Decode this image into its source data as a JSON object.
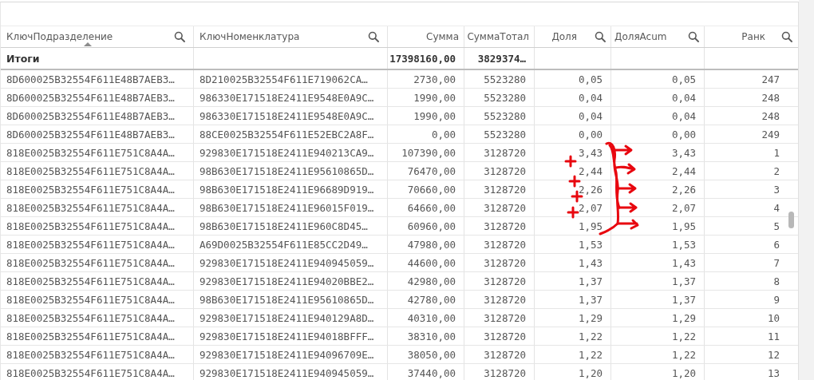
{
  "table": {
    "columns": [
      {
        "label": "КлючПодразделение",
        "kind": "dimension",
        "searchable": true,
        "sorted": true
      },
      {
        "label": "КлючНоменклатура",
        "kind": "dimension",
        "searchable": true,
        "sorted": false
      },
      {
        "label": "Сумма",
        "kind": "measure",
        "searchable": false,
        "sorted": false
      },
      {
        "label": "СуммаТотал",
        "kind": "measure",
        "searchable": false,
        "sorted": false
      },
      {
        "label": "Доля",
        "kind": "measure",
        "searchable": true,
        "sorted": false
      },
      {
        "label": "ДоляAcum",
        "kind": "measure",
        "searchable": true,
        "sorted": false
      },
      {
        "label": "Ранк",
        "kind": "measure",
        "searchable": true,
        "sorted": false
      }
    ],
    "totals": {
      "column_1": "Итоги",
      "column_3": "17398160,00",
      "column_4": "3829374…"
    },
    "rows": [
      [
        "8D600025B32554F611E48B7AEB3…",
        "8D210025B32554F611E719062CA…",
        "2730,00",
        "5523280",
        "0,05",
        "0,05",
        "247"
      ],
      [
        "8D600025B32554F611E48B7AEB3…",
        "986330E171518E2411E9548E0A9C…",
        "1990,00",
        "5523280",
        "0,04",
        "0,04",
        "248"
      ],
      [
        "8D600025B32554F611E48B7AEB3…",
        "986330E171518E2411E9548E0A9C…",
        "1990,00",
        "5523280",
        "0,04",
        "0,04",
        "248"
      ],
      [
        "8D600025B32554F611E48B7AEB3…",
        "88CE0025B32554F611E52EBC2A8F…",
        "0,00",
        "5523280",
        "0,00",
        "0,00",
        "249"
      ],
      [
        "818E0025B32554F611E751C8A4A…",
        "929830E171518E2411E940213CA9…",
        "107390,00",
        "3128720",
        "3,43",
        "3,43",
        "1"
      ],
      [
        "818E0025B32554F611E751C8A4A…",
        "98B630E171518E2411E95610865D…",
        "76470,00",
        "3128720",
        "2,44",
        "2,44",
        "2"
      ],
      [
        "818E0025B32554F611E751C8A4A…",
        "98B630E171518E2411E96689D919…",
        "70660,00",
        "3128720",
        "2,26",
        "2,26",
        "3"
      ],
      [
        "818E0025B32554F611E751C8A4A…",
        "98B630E171518E2411E96015F019…",
        "64660,00",
        "3128720",
        "2,07",
        "2,07",
        "4"
      ],
      [
        "818E0025B32554F611E751C8A4A…",
        "98B630E171518E2411E960C8D45…",
        "60960,00",
        "3128720",
        "1,95",
        "1,95",
        "5"
      ],
      [
        "818E0025B32554F611E751C8A4A…",
        "A69D0025B32554F611E85CC2D49…",
        "47980,00",
        "3128720",
        "1,53",
        "1,53",
        "6"
      ],
      [
        "818E0025B32554F611E751C8A4A…",
        "929830E171518E2411E940945059…",
        "44600,00",
        "3128720",
        "1,43",
        "1,43",
        "7"
      ],
      [
        "818E0025B32554F611E751C8A4A…",
        "929830E171518E2411E94020BBE2…",
        "42980,00",
        "3128720",
        "1,37",
        "1,37",
        "8"
      ],
      [
        "818E0025B32554F611E751C8A4A…",
        "98B630E171518E2411E95610865D…",
        "42780,00",
        "3128720",
        "1,37",
        "1,37",
        "9"
      ],
      [
        "818E0025B32554F611E751C8A4A…",
        "929830E171518E2411E940129A8D…",
        "40310,00",
        "3128720",
        "1,29",
        "1,29",
        "10"
      ],
      [
        "818E0025B32554F611E751C8A4A…",
        "929830E171518E2411E94018BFFF…",
        "38310,00",
        "3128720",
        "1,22",
        "1,22",
        "11"
      ],
      [
        "818E0025B32554F611E751C8A4A…",
        "929830E171518E2411E94096709E…",
        "38050,00",
        "3128720",
        "1,22",
        "1,22",
        "12"
      ],
      [
        "818E0025B32554F611E751C8A4A…",
        "929830E171518E2411E940945059…",
        "37440,00",
        "3128720",
        "1,20",
        "1,20",
        "13"
      ]
    ]
  }
}
